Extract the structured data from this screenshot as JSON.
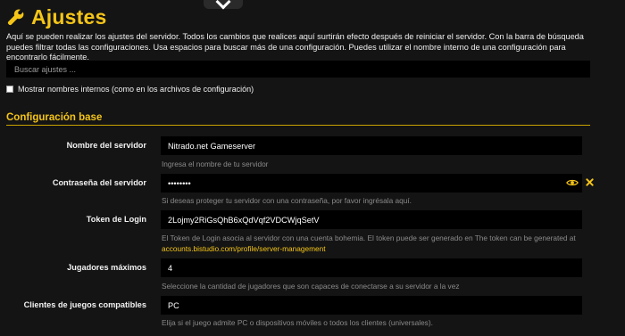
{
  "header": {
    "title": "Ajustes",
    "icon": "wrench-icon",
    "accent_color": "#f5c518"
  },
  "description": "Aquí se pueden realizar los ajustes del servidor. Todos los cambios que realices aquí surtirán efecto después de reiniciar el servidor. Con la barra de búsqueda puedes filtrar todas las configuraciones. Usa espacios para buscar más de una configuración. Puedes utilizar el nombre interno de una configuración para encontrarlo fácilmente.",
  "search": {
    "placeholder": "Buscar ajustes ...",
    "value": ""
  },
  "show_internal_names": {
    "label": "Mostrar nombres internos (como en los archivos de configuración)",
    "checked": false
  },
  "section": {
    "title": "Configuración base"
  },
  "fields": {
    "server_name": {
      "label": "Nombre del servidor",
      "value": "Nitrado.net Gameserver",
      "help": "Ingresa el nombre de tu servidor"
    },
    "server_password": {
      "label": "Contraseña del servidor",
      "value": "••••••••",
      "help": "Si deseas proteger tu servidor con una contraseña, por favor ingrésala aquí."
    },
    "login_token": {
      "label": "Token de Login",
      "value": "2Lojmy2RiGsQhB6xQdVqf2VDCWjqSetV",
      "help": "El Token de Login asocia al servidor con una cuenta bohemia. El token puede ser generado en The token can be generated at",
      "help_link": "accounts.bistudio.com/profile/server-management"
    },
    "max_players": {
      "label": "Jugadores máximos",
      "value": "4",
      "help": "Seleccione la cantidad de jugadores que son capaces de conectarse a su servidor a la vez"
    },
    "compatible_clients": {
      "label": "Clientes de juegos compatibles",
      "value": "PC",
      "help": "Elija si el juego admite PC o dispositivos móviles o todos los clientes (universales)."
    }
  }
}
